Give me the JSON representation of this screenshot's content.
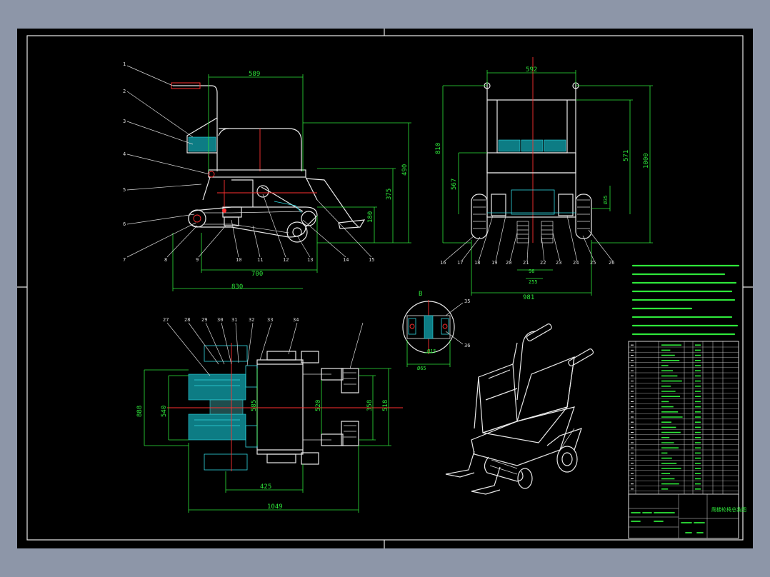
{
  "side_view": {
    "dims": {
      "top_width": "589",
      "overall_width": "830",
      "track_length": "700",
      "height_1": "490",
      "height_2": "375",
      "height_3": "180"
    },
    "balloons": [
      "1",
      "2",
      "3",
      "4",
      "5",
      "6",
      "7",
      "8",
      "9",
      "10",
      "11",
      "12",
      "13",
      "14",
      "15"
    ]
  },
  "front_view": {
    "dims": {
      "top_width": "592",
      "overall_width": "981",
      "left_height": "810",
      "mid_height": "567",
      "right_height_1": "571",
      "right_height_2": "1000",
      "small_1": "98",
      "small_2": "255",
      "small_3": "Ø35"
    },
    "balloons": [
      "16",
      "17",
      "18",
      "19",
      "20",
      "21",
      "22",
      "23",
      "24",
      "25",
      "26"
    ]
  },
  "plan_view": {
    "dims": {
      "outer_height": "888",
      "inner_height": "540",
      "mid_height": "520",
      "right_height": "518",
      "inner_width": "585",
      "bottom_mid": "425",
      "overall_length": "1049",
      "track_w": "358"
    },
    "balloons": [
      "27",
      "28",
      "29",
      "30",
      "31",
      "32",
      "33",
      "34"
    ]
  },
  "detail": {
    "label": "B",
    "dims": {
      "d1": "Ø65",
      "d2": "Ø15"
    },
    "balloons": [
      "35",
      "36"
    ]
  },
  "title_block": {
    "drawing_title": "爬楼轮椅总装图"
  }
}
